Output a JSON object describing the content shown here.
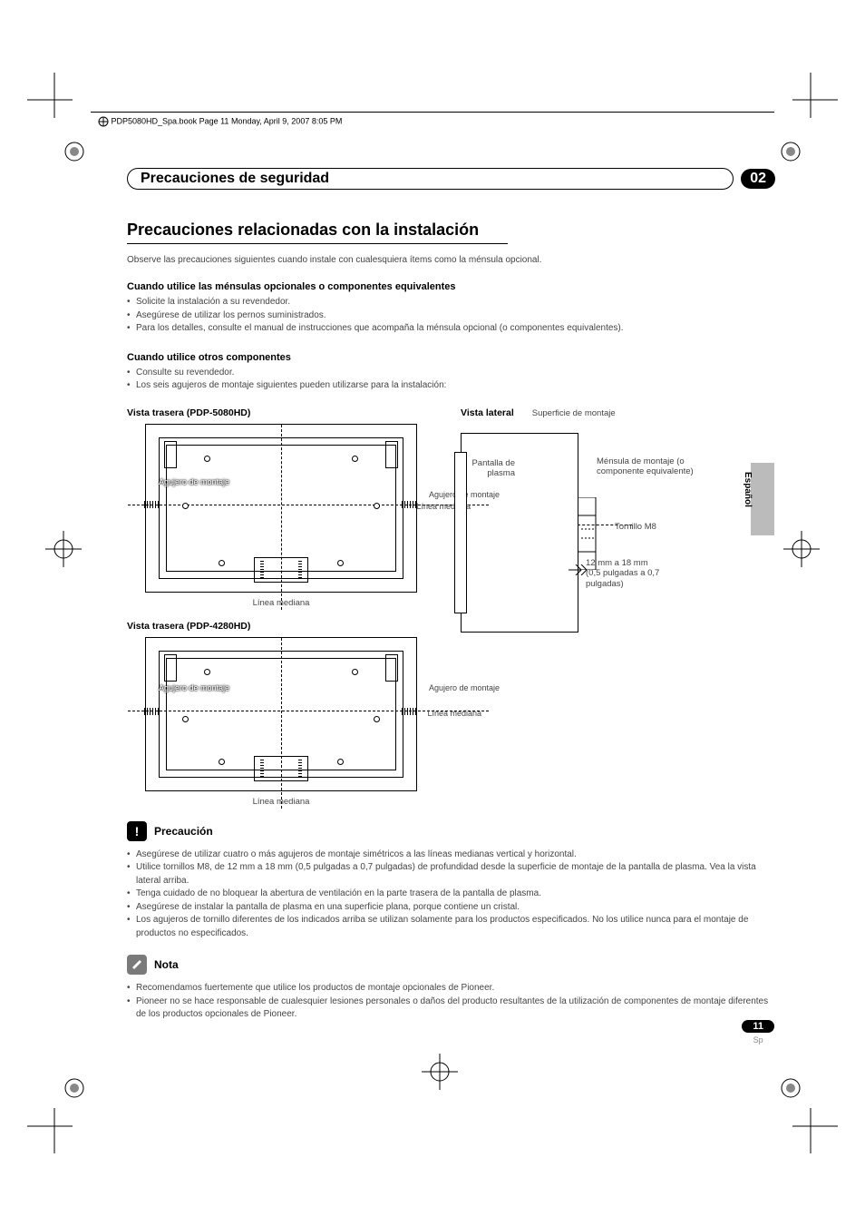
{
  "header_running": "PDP5080HD_Spa.book  Page 11  Monday, April 9, 2007  8:05 PM",
  "chapter_title": "Precauciones de seguridad",
  "chapter_number": "02",
  "section_title": "Precauciones relacionadas con la instalación",
  "intro": "Observe las precauciones siguientes cuando instale con cualesquiera ítems como la ménsula opcional.",
  "sub1_title": "Cuando utilice las ménsulas opcionales o componentes equivalentes",
  "sub1_items": [
    "Solicite la instalación a su revendedor.",
    "Asegúrese de utilizar los pernos suministrados.",
    "Para los detalles, consulte el manual de instrucciones que acompaña la ménsula opcional (o componentes equivalentes)."
  ],
  "sub2_title": "Cuando utilice otros componentes",
  "sub2_items": [
    "Consulte su revendedor.",
    "Los seis agujeros de montaje siguientes pueden utilizarse para la instalación:"
  ],
  "diag_rear1_title": "Vista trasera (PDP-5080HD)",
  "diag_rear2_title": "Vista trasera (PDP-4280HD)",
  "diag_side_title": "Vista lateral",
  "labels": {
    "agujero_de_montaje": "Agujero de montaje",
    "linea_mediana": "Línea mediana",
    "pantalla_de_plasma": "Pantalla de plasma",
    "superficie_montaje": "Superficie de montaje",
    "mensula": "Ménsula de montaje (o componente equivalente)",
    "tornillo": "Tornillo M8",
    "rango_mm": "12 mm a 18 mm",
    "rango_pulg": "(0,5 pulgadas a 0,7 pulgadas)"
  },
  "precaucion_title": "Precaución",
  "precaucion_items": [
    "Asegúrese de utilizar cuatro o más agujeros de montaje simétricos a las líneas medianas vertical y horizontal.",
    "Utilice tornillos M8, de 12 mm a 18 mm (0,5 pulgadas a 0,7 pulgadas) de profundidad desde la superficie de montaje de la pantalla de plasma. Vea la vista lateral arriba.",
    "Tenga cuidado de no bloquear la abertura de ventilación en la parte trasera de la pantalla de plasma.",
    "Asegúrese de instalar la pantalla de plasma en una superficie plana, porque contiene un cristal.",
    "Los agujeros de tornillo diferentes de los indicados arriba se utilizan solamente para los productos especificados. No los utilice nunca para el montaje de productos no especificados."
  ],
  "nota_title": "Nota",
  "nota_items": [
    "Recomendamos fuertemente que utilice los productos de montaje opcionales de Pioneer.",
    "Pioneer no se hace responsable de cualesquier lesiones personales o daños del producto resultantes de la utilización de componentes de montaje diferentes de los productos opcionales de Pioneer."
  ],
  "lang_tab": "Español",
  "page_number": "11",
  "page_lang_code": "Sp"
}
